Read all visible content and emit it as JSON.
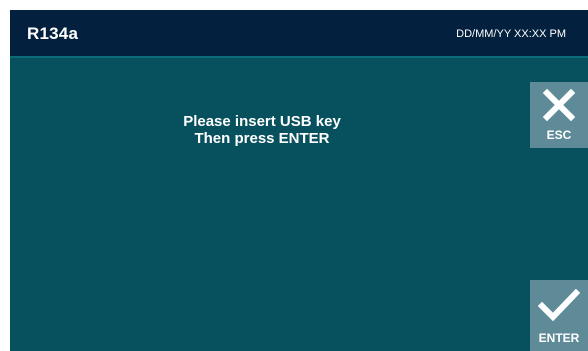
{
  "header": {
    "title": "R134a",
    "datetime": "DD/MM/YY XX:XX PM"
  },
  "message": {
    "line1": "Please insert USB key",
    "line2": "Then press ENTER"
  },
  "buttons": {
    "esc_label": "ESC",
    "enter_label": "ENTER",
    "esc_icon": "close-icon",
    "enter_icon": "checkmark-icon"
  },
  "colors": {
    "header_bg": "#03213e",
    "body_bg": "#07505e",
    "button_bg": "#5f8b99"
  }
}
